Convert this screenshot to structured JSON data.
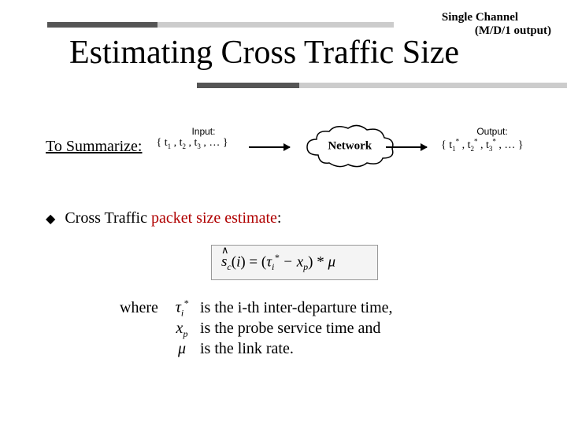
{
  "header": {
    "tag_line1": "Single Channel",
    "tag_line2": "(M/D/1 output)",
    "title": "Estimating Cross Traffic Size"
  },
  "summary": {
    "label": "To Summarize:",
    "diagram": {
      "input_label": "Input:",
      "output_label": "Output:",
      "network_label": "Network"
    }
  },
  "bullet": {
    "prefix": "Cross Traffic ",
    "highlight": "packet size estimate",
    "suffix": ":"
  },
  "where": {
    "label": "where",
    "tau_text": "is the i-th inter-departure time,",
    "xp_text": "is the probe service time and",
    "mu_text": "is the link rate."
  }
}
